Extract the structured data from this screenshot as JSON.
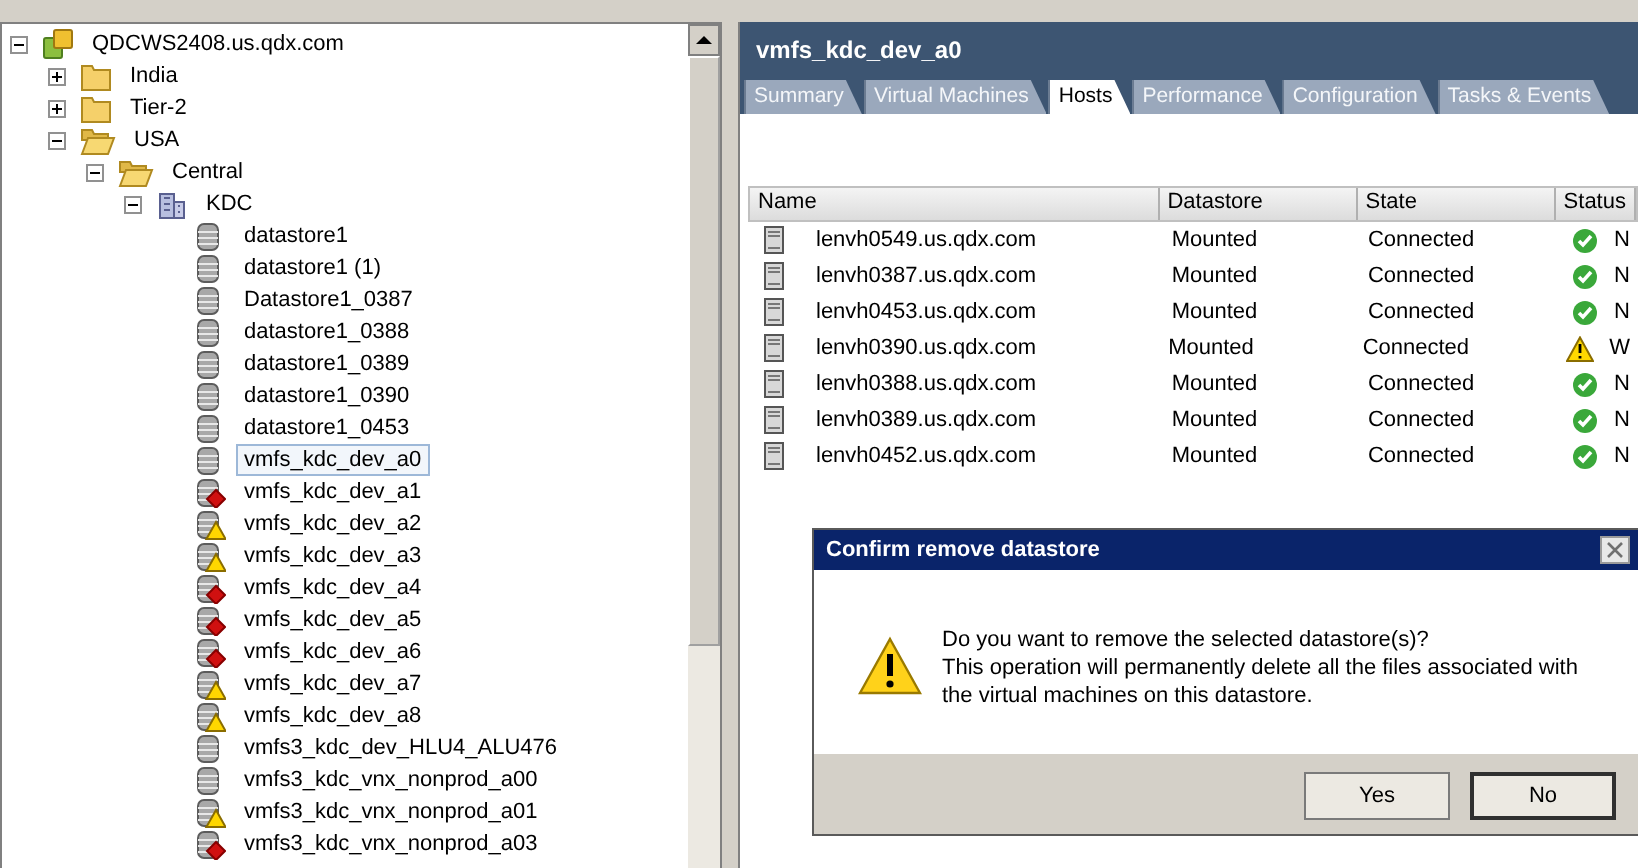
{
  "tree": [
    {
      "label": "QDCWS2408.us.qdx.com",
      "kind": "vcenter",
      "expanded": true,
      "selected": false,
      "children": [
        {
          "label": "India",
          "kind": "folder",
          "expanded": false,
          "selected": false
        },
        {
          "label": "Tier-2",
          "kind": "folder",
          "expanded": false,
          "selected": false
        },
        {
          "label": "USA",
          "kind": "folder",
          "expanded": true,
          "selected": false,
          "children": [
            {
              "label": "Central",
              "kind": "folder",
              "expanded": true,
              "selected": false,
              "children": [
                {
                  "label": "KDC",
                  "kind": "datacenter",
                  "expanded": true,
                  "selected": false,
                  "children": [
                    {
                      "label": "datastore1",
                      "kind": "datastore",
                      "selected": false
                    },
                    {
                      "label": "datastore1 (1)",
                      "kind": "datastore",
                      "selected": false
                    },
                    {
                      "label": "Datastore1_0387",
                      "kind": "datastore",
                      "selected": false
                    },
                    {
                      "label": "datastore1_0388",
                      "kind": "datastore",
                      "selected": false
                    },
                    {
                      "label": "datastore1_0389",
                      "kind": "datastore",
                      "selected": false
                    },
                    {
                      "label": "datastore1_0390",
                      "kind": "datastore",
                      "selected": false
                    },
                    {
                      "label": "datastore1_0453",
                      "kind": "datastore",
                      "selected": false
                    },
                    {
                      "label": "vmfs_kdc_dev_a0",
                      "kind": "datastore",
                      "selected": true
                    },
                    {
                      "label": "vmfs_kdc_dev_a1",
                      "kind": "faulted",
                      "selected": false
                    },
                    {
                      "label": "vmfs_kdc_dev_a2",
                      "kind": "warned",
                      "selected": false
                    },
                    {
                      "label": "vmfs_kdc_dev_a3",
                      "kind": "warned",
                      "selected": false
                    },
                    {
                      "label": "vmfs_kdc_dev_a4",
                      "kind": "faulted",
                      "selected": false
                    },
                    {
                      "label": "vmfs_kdc_dev_a5",
                      "kind": "faulted",
                      "selected": false
                    },
                    {
                      "label": "vmfs_kdc_dev_a6",
                      "kind": "faulted",
                      "selected": false
                    },
                    {
                      "label": "vmfs_kdc_dev_a7",
                      "kind": "warned",
                      "selected": false
                    },
                    {
                      "label": "vmfs_kdc_dev_a8",
                      "kind": "warned",
                      "selected": false
                    },
                    {
                      "label": "vmfs3_kdc_dev_HLU4_ALU476",
                      "kind": "datastore",
                      "selected": false
                    },
                    {
                      "label": "vmfs3_kdc_vnx_nonprod_a00",
                      "kind": "datastore",
                      "selected": false
                    },
                    {
                      "label": "vmfs3_kdc_vnx_nonprod_a01",
                      "kind": "warned",
                      "selected": false
                    },
                    {
                      "label": "vmfs3_kdc_vnx_nonprod_a03",
                      "kind": "faulted",
                      "selected": false
                    }
                  ]
                }
              ]
            }
          ]
        }
      ]
    }
  ],
  "panel": {
    "title": "vmfs_kdc_dev_a0",
    "tabs": [
      {
        "label": "Summary",
        "selected": false
      },
      {
        "label": "Virtual Machines",
        "selected": false
      },
      {
        "label": "Hosts",
        "selected": true
      },
      {
        "label": "Performance",
        "selected": false
      },
      {
        "label": "Configuration",
        "selected": false
      },
      {
        "label": "Tasks & Events",
        "selected": false
      }
    ],
    "table": {
      "columns": [
        "Name",
        "Datastore",
        "State",
        "Status"
      ],
      "rows": [
        {
          "name": "lenvh0549.us.qdx.com",
          "datastore": "Mounted",
          "state": "Connected",
          "kind": "ok",
          "status": "N"
        },
        {
          "name": "lenvh0387.us.qdx.com",
          "datastore": "Mounted",
          "state": "Connected",
          "kind": "ok",
          "status": "N"
        },
        {
          "name": "lenvh0453.us.qdx.com",
          "datastore": "Mounted",
          "state": "Connected",
          "kind": "ok",
          "status": "N"
        },
        {
          "name": "lenvh0390.us.qdx.com",
          "datastore": "Mounted",
          "state": "Connected",
          "kind": "warning",
          "status": "W"
        },
        {
          "name": "lenvh0388.us.qdx.com",
          "datastore": "Mounted",
          "state": "Connected",
          "kind": "ok",
          "status": "N"
        },
        {
          "name": "lenvh0389.us.qdx.com",
          "datastore": "Mounted",
          "state": "Connected",
          "kind": "ok",
          "status": "N"
        },
        {
          "name": "lenvh0452.us.qdx.com",
          "datastore": "Mounted",
          "state": "Connected",
          "kind": "ok",
          "status": "N"
        }
      ]
    }
  },
  "dialog": {
    "title": "Confirm remove datastore",
    "lines": [
      "Do you want to remove the selected datastore(s)?",
      "This operation will permanently delete all the files associated with",
      "the virtual machines on this datastore."
    ],
    "buttons": [
      {
        "label": "Yes",
        "focused": false
      },
      {
        "label": "No",
        "focused": true
      }
    ]
  }
}
